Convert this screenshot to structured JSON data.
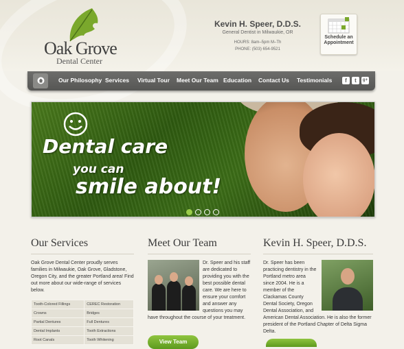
{
  "logo": {
    "name": "Oak Grove",
    "subtitle": "Dental Center"
  },
  "contact": {
    "doctor_name": "Kevin H. Speer, D.D.S.",
    "title": "General Dentist in Milwaukie, OR",
    "hours": "HOURS: 8am–5pm M–Th",
    "phone": "PHONE: (503) 654-9521"
  },
  "schedule": {
    "line1": "Schedule an",
    "line2": "Appointment"
  },
  "nav": {
    "items": [
      "Our Philosophy",
      "Services",
      "Virtual Tour",
      "Meet Our Team",
      "Education",
      "Contact Us",
      "Testimonials"
    ],
    "social": [
      "f",
      "t",
      "g+"
    ]
  },
  "hero": {
    "line1": "Dental care",
    "line2": "you can",
    "line3": "smile about!",
    "slides": 4,
    "active_slide": 1
  },
  "services": {
    "heading": "Our Services",
    "intro": "Oak Grove Dental Center proudly serves families in Milwaukie, Oak Grove, Gladstone, Oregon City, and the greater Portland area! Find out more about our wide-range of services below.",
    "rows": [
      [
        "Tooth-Colored Fillings",
        "CEREC Restoration"
      ],
      [
        "Crowns",
        "Bridges"
      ],
      [
        "Partial Dentures",
        "Full Dentures"
      ],
      [
        "Dental Implants",
        "Tooth Extractions"
      ],
      [
        "Root Canals",
        "Tooth Whitening"
      ]
    ]
  },
  "team": {
    "heading": "Meet Our Team",
    "text": "Dr. Speer and his staff are dedicated to providing you with the best possible dental care. We are here to ensure your comfort and answer any questions you may have throughout the course of your treatment.",
    "button": "View Team"
  },
  "doctor": {
    "heading": "Kevin H. Speer, D.D.S.",
    "text": "Dr. Speer has been practicing dentistry in the Portland metro area since 2004. He is a member of the Clackamas County Dental Society, Oregon Dental Association, and American Dental Association. He is also the former president of the Portland Chapter of Delta Sigma Delta."
  }
}
